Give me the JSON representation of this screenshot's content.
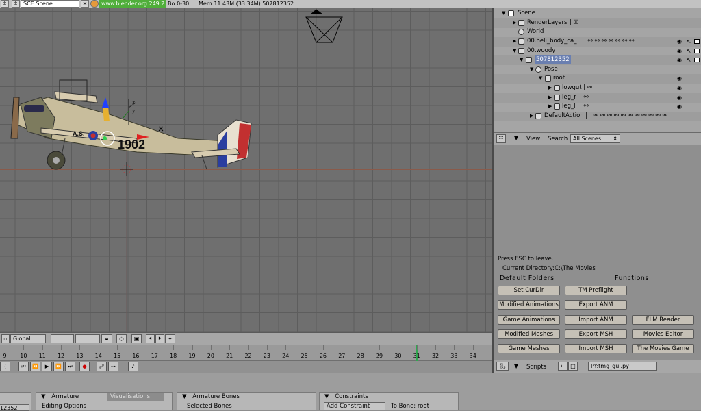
{
  "topbar": {
    "scene_label": "SCE:Scene",
    "url": "www.blender.org 249.2",
    "frames": "Bo:0-30",
    "memory": "Mem:11.43M (33.34M) 507812352"
  },
  "viewport": {
    "plane_number": "1902",
    "plane_letters": "A.S.",
    "axis_z": "z",
    "axis_y": "y"
  },
  "viewport_header": {
    "orientation": "Global"
  },
  "timeline": {
    "ticks": [
      "9",
      "10",
      "11",
      "12",
      "13",
      "14",
      "15",
      "16",
      "17",
      "18",
      "19",
      "20",
      "21",
      "22",
      "23",
      "24",
      "25",
      "26",
      "27",
      "28",
      "29",
      "30",
      "31",
      "32",
      "33",
      "34"
    ],
    "current_frame": "31"
  },
  "outliner": {
    "rows": [
      {
        "label": "Scene"
      },
      {
        "label": "RenderLayers"
      },
      {
        "label": "World"
      },
      {
        "label": "00.heli_body_ca_"
      },
      {
        "label": "00.woody"
      },
      {
        "label": "507812352"
      },
      {
        "label": "Pose"
      },
      {
        "label": "root"
      },
      {
        "label": "lowgut"
      },
      {
        "label": "leg_r"
      },
      {
        "label": "leg_l"
      },
      {
        "label": "DefaultAction"
      }
    ],
    "header": {
      "view": "View",
      "search": "Search",
      "scope": "All Scenes"
    }
  },
  "scripts": {
    "esc_text": "Press ESC to leave.",
    "current_dir": "Current Directory:C:\\The Movies",
    "default_folders": "Default Folders",
    "functions": "Functions",
    "buttons": {
      "set_curdir": "Set CurDir",
      "tm_preflight": "TM Preflight",
      "modified_animations": "Modified Animations",
      "export_anm": "Export ANM",
      "game_animations": "Game Animations",
      "import_anm": "Import ANM",
      "flm_reader": "FLM Reader",
      "modified_meshes": "Modified Meshes",
      "export_msh": "Export MSH",
      "movies_editor": "Movies Editor",
      "game_meshes": "Game Meshes",
      "import_msh": "Import MSH",
      "the_movies_game": "The Movies Game"
    },
    "header": {
      "label": "Scripts",
      "file": "PY:tmg_gui.py"
    }
  },
  "bottom": {
    "frame_field": "12352",
    "armature_tab": "Armature",
    "visualisations_tab": "Visualisations",
    "editing_options": "Editing Options",
    "armature_bones_tab": "Armature Bones",
    "selected_bones": "Selected Bones",
    "constraints_tab": "Constraints",
    "add_constraint": "Add Constraint",
    "to_bone": "To Bone: root"
  },
  "colors": {
    "accent_green": "#2fa84f",
    "button": "#c5c0b6",
    "grid": "#6f6f6f"
  }
}
